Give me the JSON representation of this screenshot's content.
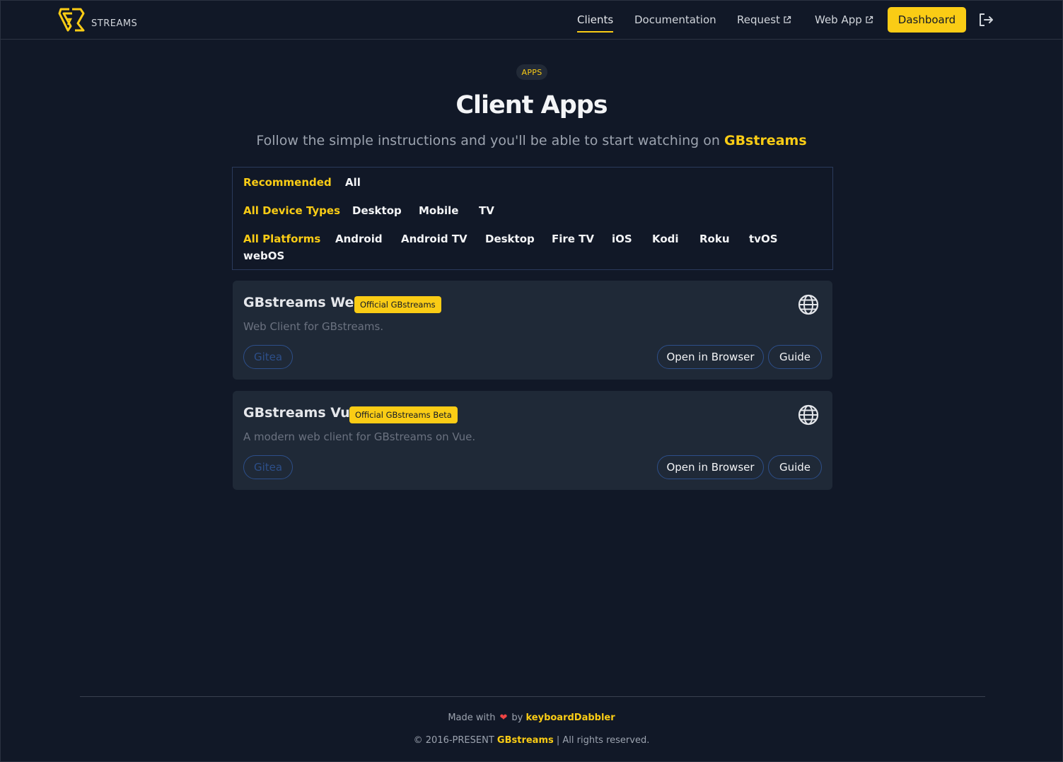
{
  "header": {
    "logo_text": "STREAMS",
    "nav": {
      "clients": "Clients",
      "documentation": "Documentation",
      "request": "Request",
      "web_app": "Web App"
    },
    "dashboard_label": "Dashboard"
  },
  "hero": {
    "badge": "APPS",
    "title": "Client Apps",
    "subtitle": "Follow the simple instructions and you'll be able to start watching on ",
    "subtitle_brand": "GBstreams"
  },
  "filters": {
    "row1": [
      "Recommended",
      "All"
    ],
    "row2": [
      "All Device Types",
      "Desktop",
      "Mobile",
      "TV"
    ],
    "row3": [
      "All Platforms",
      "Android",
      "Android TV",
      "Desktop",
      "Fire TV",
      "iOS",
      "Kodi",
      "Roku",
      "tvOS",
      "webOS"
    ]
  },
  "cards": [
    {
      "title": "GBstreams Web",
      "badge": "Official GBstreams",
      "description": "Web Client for GBstreams.",
      "source_label": "Gitea",
      "open_label": "Open in Browser",
      "guide_label": "Guide"
    },
    {
      "title": "GBstreams Vue",
      "badge": "Official GBstreams Beta",
      "description": "A modern web client for GBstreams on Vue.",
      "source_label": "Gitea",
      "open_label": "Open in Browser",
      "guide_label": "Guide"
    }
  ],
  "footer": {
    "made_with": "Made with",
    "by": "by",
    "author": "keyboardDabbler",
    "copyright": "© 2016-PRESENT",
    "brand": "GBstreams",
    "rights": "| All rights reserved."
  },
  "colors": {
    "background": "#111827",
    "card": "#1f2937",
    "accent": "#facc15",
    "pill_border": "#2d4f8a"
  }
}
